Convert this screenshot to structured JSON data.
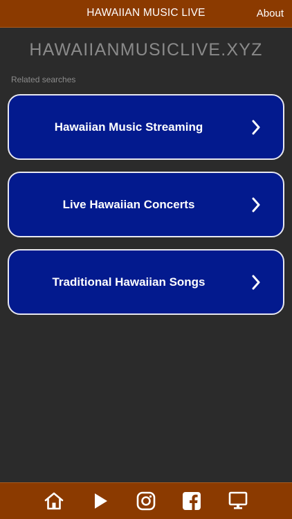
{
  "header": {
    "title": "HAWAIIAN MUSIC LIVE",
    "about_label": "About"
  },
  "main": {
    "domain_title": "HAWAIIANMUSICLIVE.XYZ",
    "related_label": "Related searches",
    "links": [
      {
        "label": "Hawaiian Music Streaming",
        "icon": "chevron-right-icon"
      },
      {
        "label": "Live Hawaiian Concerts",
        "icon": "chevron-right-icon"
      },
      {
        "label": "Traditional Hawaiian Songs",
        "icon": "chevron-right-icon"
      }
    ]
  },
  "bottom_nav": {
    "items": [
      {
        "icon": "home-icon"
      },
      {
        "icon": "play-icon"
      },
      {
        "icon": "instagram-icon"
      },
      {
        "icon": "facebook-icon"
      },
      {
        "icon": "monitor-icon"
      }
    ]
  },
  "colors": {
    "bar": "#8b3a00",
    "background": "#2b2b2b",
    "card": "#031a8e",
    "card_border": "#e8e8f0",
    "muted_text": "#8a8a8a"
  }
}
